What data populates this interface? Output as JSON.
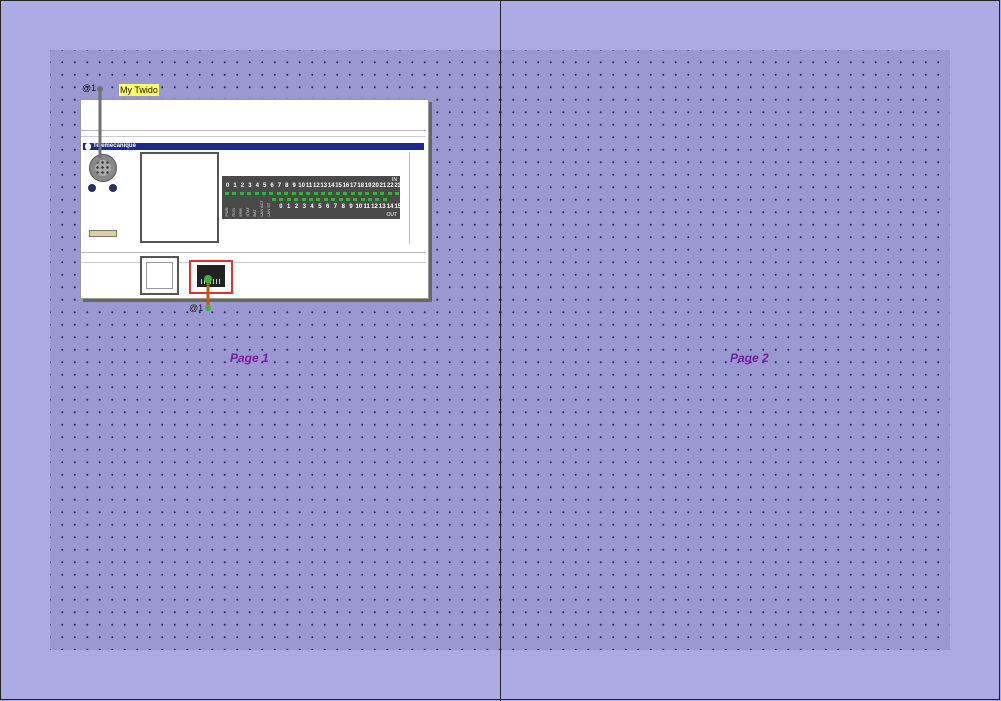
{
  "pages": [
    {
      "label": "Page 1"
    },
    {
      "label": "Page 2"
    }
  ],
  "device": {
    "title": "My Twido",
    "brand": "Telemecanique",
    "serial_port_tag": "@1",
    "ethernet_port_tag": "@1",
    "led_inputs": [
      "0",
      "1",
      "2",
      "3",
      "4",
      "5",
      "6",
      "7",
      "8",
      "9",
      "10",
      "11",
      "12",
      "13",
      "14",
      "15",
      "16",
      "17",
      "18",
      "19",
      "20",
      "21",
      "22",
      "23"
    ],
    "led_outputs": [
      "0",
      "1",
      "2",
      "3",
      "4",
      "5",
      "6",
      "7",
      "8",
      "9",
      "10",
      "11",
      "12",
      "13",
      "14",
      "15"
    ],
    "led_in_label": "IN",
    "led_out_label": "OUT",
    "status_labels": [
      "PWR",
      "RUN",
      "ERR",
      "STAT",
      "BAT",
      "LAN ACT",
      "LAN ST"
    ]
  },
  "colors": {
    "background": "#acaae2",
    "print_area": "#9a98d1",
    "page_label": "#7a1ba0",
    "title_tag": "#ffff66",
    "led_on": "#2db533",
    "ethernet_port_border": "#dd3333",
    "brand_bar": "#1b2a8c"
  }
}
